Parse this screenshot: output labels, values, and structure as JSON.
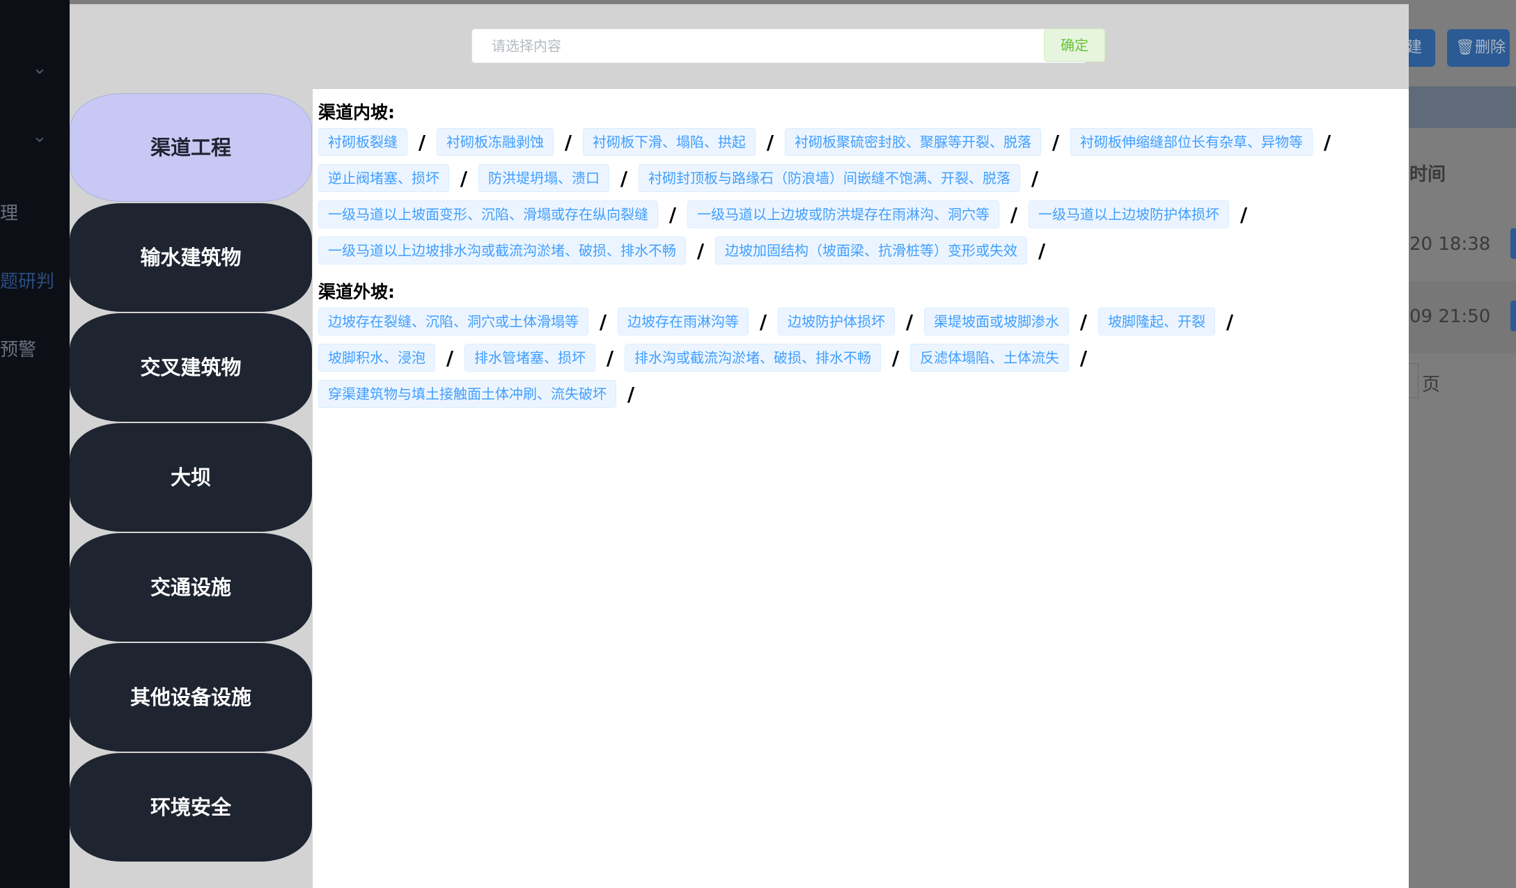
{
  "background": {
    "nav_labels": [
      "理",
      "题研判",
      "预警"
    ],
    "new_button_label": "建",
    "delete_button_label": "删除",
    "table_header": "时间",
    "row_times": [
      "20 18:38",
      "09 21:50"
    ],
    "page_label": "页"
  },
  "modal": {
    "search": {
      "placeholder": "请选择内容",
      "value": ""
    },
    "confirm_label": "确定",
    "categories": [
      {
        "label": "渠道工程",
        "active": true
      },
      {
        "label": "输水建筑物",
        "active": false
      },
      {
        "label": "交叉建筑物",
        "active": false
      },
      {
        "label": "大坝",
        "active": false
      },
      {
        "label": "交通设施",
        "active": false
      },
      {
        "label": "其他设备设施",
        "active": false
      },
      {
        "label": "环境安全",
        "active": false
      }
    ],
    "separator": "/",
    "sections": [
      {
        "title": "渠道内坡:",
        "tags": [
          "衬砌板裂缝",
          "衬砌板冻融剥蚀",
          "衬砌板下滑、塌陷、拱起",
          "衬砌板聚硫密封胶、聚脲等开裂、脱落",
          "衬砌板伸缩缝部位长有杂草、异物等",
          "逆止阀堵塞、损坏",
          "防洪堤坍塌、溃口",
          "衬砌封顶板与路缘石（防浪墙）间嵌缝不饱满、开裂、脱落",
          "一级马道以上坡面变形、沉陷、滑塌或存在纵向裂缝",
          "一级马道以上边坡或防洪堤存在雨淋沟、洞穴等",
          "一级马道以上边坡防护体损坏",
          "一级马道以上边坡排水沟或截流沟淤堵、破损、排水不畅",
          "边坡加固结构（坡面梁、抗滑桩等）变形或失效"
        ]
      },
      {
        "title": "渠道外坡:",
        "tags": [
          "边坡存在裂缝、沉陷、洞穴或土体滑塌等",
          "边坡存在雨淋沟等",
          "边坡防护体损坏",
          "渠堤坡面或坡脚渗水",
          "坡脚隆起、开裂",
          "坡脚积水、浸泡",
          "排水管堵塞、损坏",
          "排水沟或截流沟淤堵、破损、排水不畅",
          "反滤体塌陷、土体流失",
          "穿渠建筑物与填土接触面土体冲刷、流失破坏"
        ]
      }
    ]
  }
}
